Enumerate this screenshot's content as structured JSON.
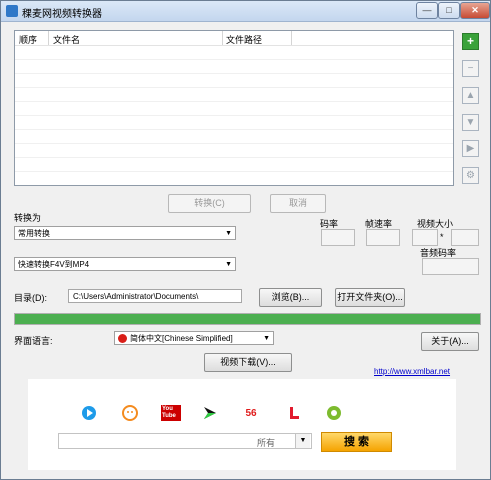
{
  "window": {
    "title": "稞麦网视频转换器"
  },
  "file_table": {
    "columns": [
      "顺序",
      "文件名",
      "文件路径"
    ],
    "rows": []
  },
  "side_toolbar": {
    "add": "+",
    "remove": "−",
    "up": "▲",
    "down": "▼",
    "play": "▶",
    "settings": "⚙"
  },
  "actions": {
    "convert": "转换(C)",
    "cancel": "取消"
  },
  "convert_to": {
    "label": "转换为",
    "category": "常用转换",
    "format": "快速转换F4V到MP4"
  },
  "params": {
    "bitrate_label": "码率",
    "framerate_label": "帧速率",
    "video_size_label": "视频大小",
    "size_sep": "*",
    "audio_bitrate_label": "音频码率"
  },
  "directory": {
    "label": "目录(D):",
    "value": "C:\\Users\\Administrator\\Documents\\",
    "browse": "浏览(B)...",
    "open_folder": "打开文件夹(O)..."
  },
  "progress": {
    "value": 1.0,
    "color": "#4caf50"
  },
  "language": {
    "label": "界面语言:",
    "selected": "简体中文[Chinese Simplified]",
    "about": "关于(A)..."
  },
  "video_download": "视频下载(V)...",
  "website": "http://www.xmlbar.net",
  "search": {
    "icons": [
      "youku-icon",
      "tudou-icon",
      "youtube-icon",
      "iqiyi-icon",
      "56-icon",
      "letv-icon",
      "acfun-icon"
    ],
    "youtube_text": "You Tube",
    "56_text": "56",
    "scope": "所有",
    "button": "搜 索"
  }
}
